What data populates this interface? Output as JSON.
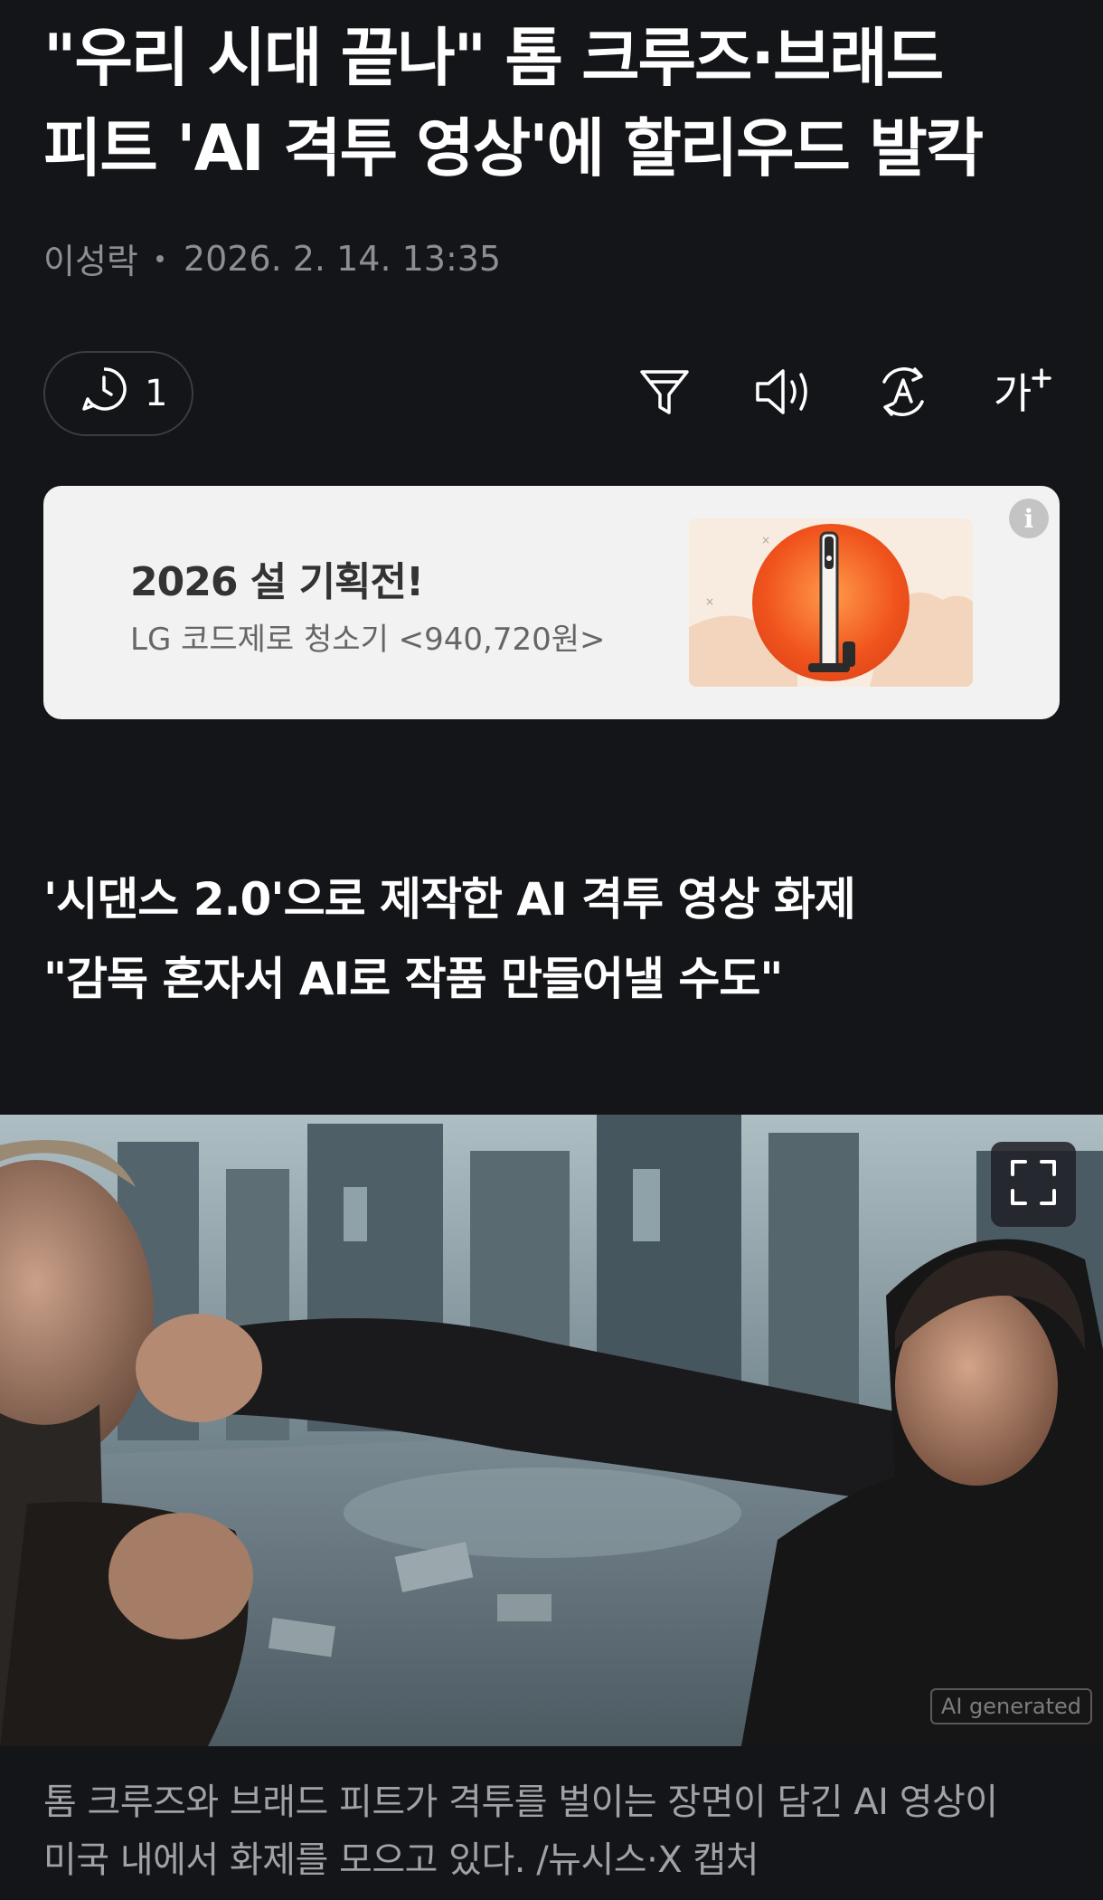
{
  "article": {
    "headline_line1": "\"우리 시대 끝나\" 톰 크루즈·브래드",
    "headline_line2": "피트 'AI 격투 영상'에 할리우드 발칵",
    "author": "이성락",
    "timestamp": "2026. 2. 14. 13:35",
    "comment_count": "1",
    "subhead_line1": "'시댄스 2.0'으로 제작한 AI 격투 영상 화제",
    "subhead_line2": "\"감독 혼자서 AI로 작품 만들어낼 수도\"",
    "photo_tag": "AI generated",
    "caption_line1": "톰 크루즈와 브래드 피트가 격투를 벌이는 장면이 담긴 AI 영상이",
    "caption_line2": "미국 내에서 화제를 모으고 있다. /뉴시스·X 캡처"
  },
  "toolbar": {
    "icons": [
      "summary-filter-icon",
      "speaker-icon",
      "translate-icon",
      "font-size-icon"
    ],
    "font_size_label": "가"
  },
  "ad": {
    "title": "2026 설 기획전!",
    "subtitle": "LG 코드제로 청소기 <940,720원>",
    "info_icon": "i"
  },
  "colors": {
    "background": "#141518",
    "ad_background": "#f2f2f2",
    "muted_text": "#8c8e94"
  }
}
